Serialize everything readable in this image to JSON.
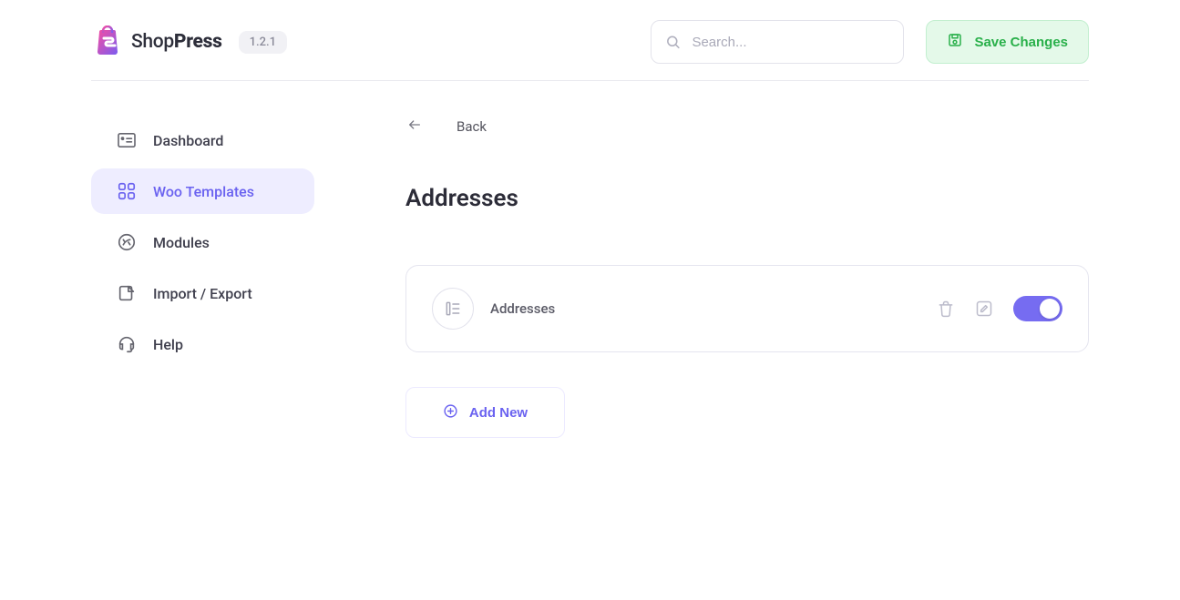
{
  "brand": {
    "name_light": "Shop",
    "name_bold": "Press",
    "version": "1.2.1"
  },
  "header": {
    "search_placeholder": "Search...",
    "save_label": "Save Changes"
  },
  "sidebar": {
    "items": [
      {
        "label": "Dashboard"
      },
      {
        "label": "Woo Templates"
      },
      {
        "label": "Modules"
      },
      {
        "label": "Import / Export"
      },
      {
        "label": "Help"
      }
    ]
  },
  "main": {
    "back_label": "Back",
    "page_title": "Addresses",
    "template_card": {
      "label": "Addresses",
      "enabled": true
    },
    "add_new_label": "Add New"
  }
}
